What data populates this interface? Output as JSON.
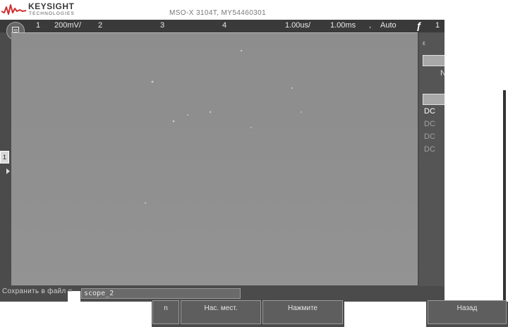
{
  "brand": {
    "name": "KEYSIGHT",
    "sub": "TECHNOLOGIES"
  },
  "header": {
    "model": "MSO-X 3104T, MY54460301",
    "datetime": ""
  },
  "status_bar": {
    "ch1_label": "1",
    "ch1_scale": "200mV/",
    "ch2_label": "2",
    "ch3_label": "3",
    "ch4_label": "4",
    "timebase": "1.00us/",
    "delay": "1.00ms",
    "sep": ",",
    "trigger_mode": "Auto",
    "trigger_icon": "ƒ",
    "trigger_channel": "1"
  },
  "left_marker": {
    "label": "1"
  },
  "right_panel": {
    "dot": "ε",
    "n_label": "N",
    "coupling": [
      "DC",
      "DC",
      "DC",
      "DC"
    ]
  },
  "command_line": {
    "label": "Сохранить в файл =",
    "value": "scope_2"
  },
  "softkeys": [
    {
      "label": "n"
    },
    {
      "label": "Нас. мест."
    },
    {
      "label": "Нажмите"
    },
    {
      "label": "Назад"
    }
  ],
  "colors": {
    "frame": "#4b4b4b",
    "graticule": "#8f8f8f",
    "text": "#e8e8e8",
    "coupling_active": "#ffffff",
    "coupling_inactive": "#9a9a9a"
  },
  "icons": {
    "menu": "menu-icon",
    "brand": "keysight-wave-logo",
    "trigger": "trigger-edge-icon"
  }
}
